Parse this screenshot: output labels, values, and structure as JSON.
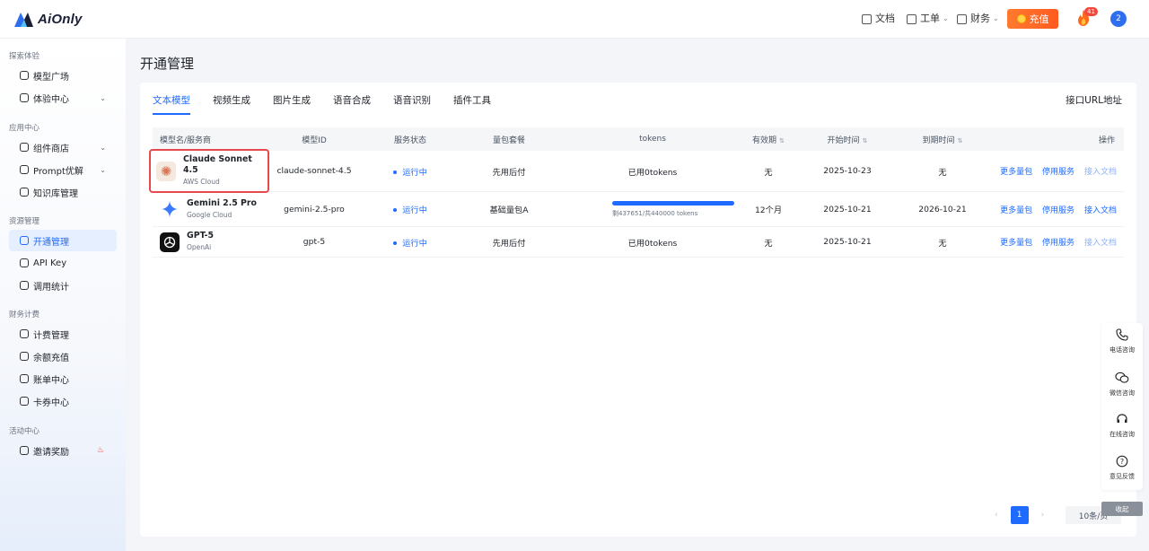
{
  "header": {
    "brand": "AiOnly",
    "nav": [
      {
        "label": "文档",
        "icon": "doc-icon",
        "dropdown": false
      },
      {
        "label": "工单",
        "icon": "ticket-icon",
        "dropdown": true
      },
      {
        "label": "财务",
        "icon": "finance-icon",
        "dropdown": true
      }
    ],
    "recharge_label": "充值",
    "fire_badge": "41",
    "avatar_label": "2"
  },
  "sidebar": {
    "sections": [
      {
        "title": "探索体验",
        "items": [
          {
            "label": "模型广场",
            "icon": "cube-icon"
          },
          {
            "label": "体验中心",
            "icon": "experiment-icon",
            "dropdown": true
          }
        ]
      },
      {
        "title": "应用中心",
        "items": [
          {
            "label": "组件商店",
            "icon": "store-icon",
            "dropdown": true
          },
          {
            "label": "Prompt优解",
            "icon": "bulb-icon",
            "dropdown": true
          },
          {
            "label": "知识库管理",
            "icon": "book-icon"
          }
        ]
      },
      {
        "title": "资源管理",
        "items": [
          {
            "label": "开通管理",
            "icon": "diamond-icon",
            "active": true
          },
          {
            "label": "API Key",
            "icon": "key-icon"
          },
          {
            "label": "调用统计",
            "icon": "stats-icon"
          }
        ]
      },
      {
        "title": "财务计费",
        "items": [
          {
            "label": "计费管理",
            "icon": "billing-icon"
          },
          {
            "label": "余额充值",
            "icon": "balance-icon"
          },
          {
            "label": "账单中心",
            "icon": "bill-icon"
          },
          {
            "label": "卡券中心",
            "icon": "coupon-icon"
          }
        ]
      },
      {
        "title": "活动中心",
        "items": [
          {
            "label": "邀请奖励",
            "icon": "gift-icon",
            "hot": true
          }
        ]
      }
    ]
  },
  "main": {
    "title": "开通管理",
    "tabs": [
      "文本模型",
      "视频生成",
      "图片生成",
      "语音合成",
      "语音识别",
      "插件工具"
    ],
    "active_tab": 0,
    "right_link": "接口URL地址",
    "table": {
      "headers": [
        "模型名/服务商",
        "模型ID",
        "服务状态",
        "量包套餐",
        "tokens",
        "有效期",
        "开始时间",
        "到期时间",
        "操作"
      ],
      "rows": [
        {
          "name": "Claude Sonnet 4.5",
          "provider": "AWS Cloud",
          "model_id": "claude-sonnet-4.5",
          "status": "运行中",
          "plan": "先用后付",
          "tokens": "已用0tokens",
          "validity": "无",
          "start": "2025-10-23",
          "end": "无",
          "ops": [
            "更多量包",
            "停用服务",
            "接入文档"
          ],
          "doc_enabled": false,
          "highlighted": true
        },
        {
          "name": "Gemini 2.5 Pro",
          "provider": "Google Cloud",
          "model_id": "gemini-2.5-pro",
          "status": "运行中",
          "plan": "基础量包A",
          "tokens_remaining_text": "剩437651/共440000 tokens",
          "tokens_remaining": 437651,
          "tokens_total": 440000,
          "validity": "12个月",
          "start": "2025-10-21",
          "end": "2026-10-21",
          "ops": [
            "更多量包",
            "停用服务",
            "接入文档"
          ],
          "doc_enabled": true
        },
        {
          "name": "GPT-5",
          "provider": "OpenAi",
          "model_id": "gpt-5",
          "status": "运行中",
          "plan": "先用后付",
          "tokens": "已用0tokens",
          "validity": "无",
          "start": "2025-10-21",
          "end": "无",
          "ops": [
            "更多量包",
            "停用服务",
            "接入文档"
          ],
          "doc_enabled": false
        }
      ]
    },
    "pagination": {
      "current": "1",
      "prev": "‹",
      "next": "›",
      "page_size": "10条/页"
    }
  },
  "float_panel": {
    "items": [
      {
        "label": "电话咨询",
        "icon": "phone-icon"
      },
      {
        "label": "微信咨询",
        "icon": "wechat-icon"
      },
      {
        "label": "在线咨询",
        "icon": "headset-icon"
      },
      {
        "label": "意见反馈",
        "icon": "question-icon"
      }
    ],
    "collapse_label": "收起"
  },
  "colors": {
    "accent": "#1f6bff",
    "recharge": "#ff6a25",
    "highlight": "#e5484d"
  }
}
